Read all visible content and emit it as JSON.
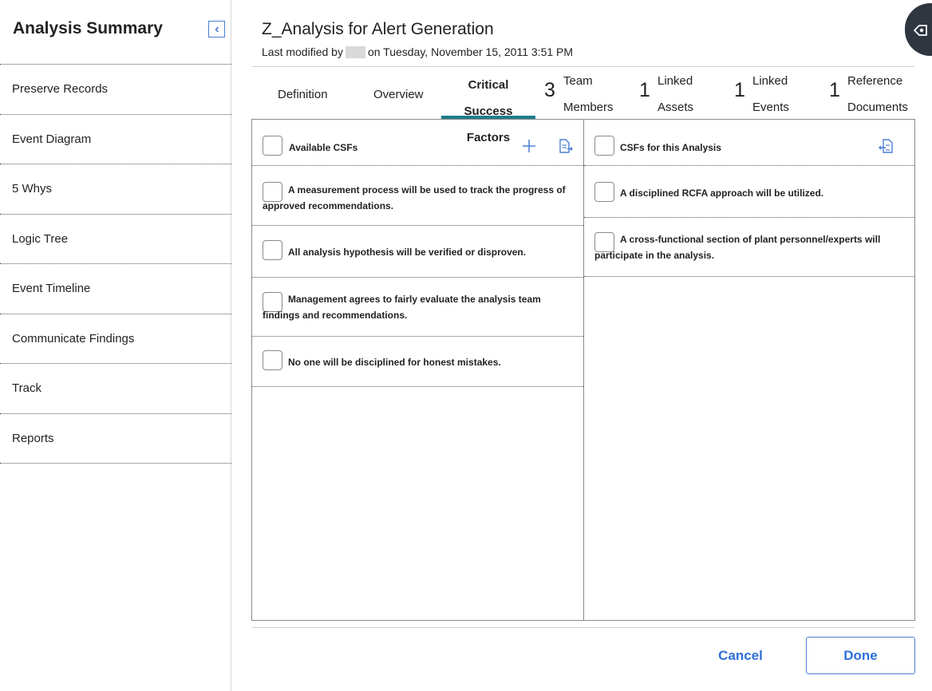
{
  "sidebar": {
    "title": "Analysis Summary",
    "collapse_icon": "chevron-left-icon",
    "items": [
      {
        "label": "Preserve Records"
      },
      {
        "label": "Event Diagram"
      },
      {
        "label": "5 Whys"
      },
      {
        "label": "Logic Tree"
      },
      {
        "label": "Event Timeline"
      },
      {
        "label": "Communicate Findings"
      },
      {
        "label": "Track"
      },
      {
        "label": "Reports"
      }
    ]
  },
  "header": {
    "title": "Z_Analysis for Alert Generation",
    "modified_prefix": "Last modified by",
    "modified_suffix": "on Tuesday, November 15, 2011 3:51 PM"
  },
  "tabs": {
    "definition": "Definition",
    "overview": "Overview",
    "active": {
      "line1": "Critical",
      "line2": "Success",
      "line3": "Factors"
    },
    "team": {
      "count": "3",
      "line1": "Team",
      "line2": "Members"
    },
    "assets": {
      "count": "1",
      "line1": "Linked",
      "line2": "Assets"
    },
    "events": {
      "count": "1",
      "line1": "Linked",
      "line2": "Events"
    },
    "documents": {
      "count": "1",
      "line1": "Reference",
      "line2": "Documents"
    }
  },
  "available": {
    "header": "Available CSFs",
    "items": [
      "A measurement process will be used to track the progress of approved recommendations.",
      "All analysis hypothesis will be verified or disproven.",
      "Management agrees to fairly evaluate the analysis team findings and recommendations.",
      "No one will be disciplined for honest mistakes."
    ]
  },
  "selected": {
    "header": "CSFs for this Analysis",
    "items": [
      "A disciplined RCFA approach will be utilized.",
      "A cross-functional section of plant personnel/experts will participate in the analysis."
    ]
  },
  "footer": {
    "cancel": "Cancel",
    "done": "Done"
  },
  "colors": {
    "accent": "#2f6fd6",
    "tab_underline": "#1e7d8a",
    "badge": "#2f3640"
  }
}
